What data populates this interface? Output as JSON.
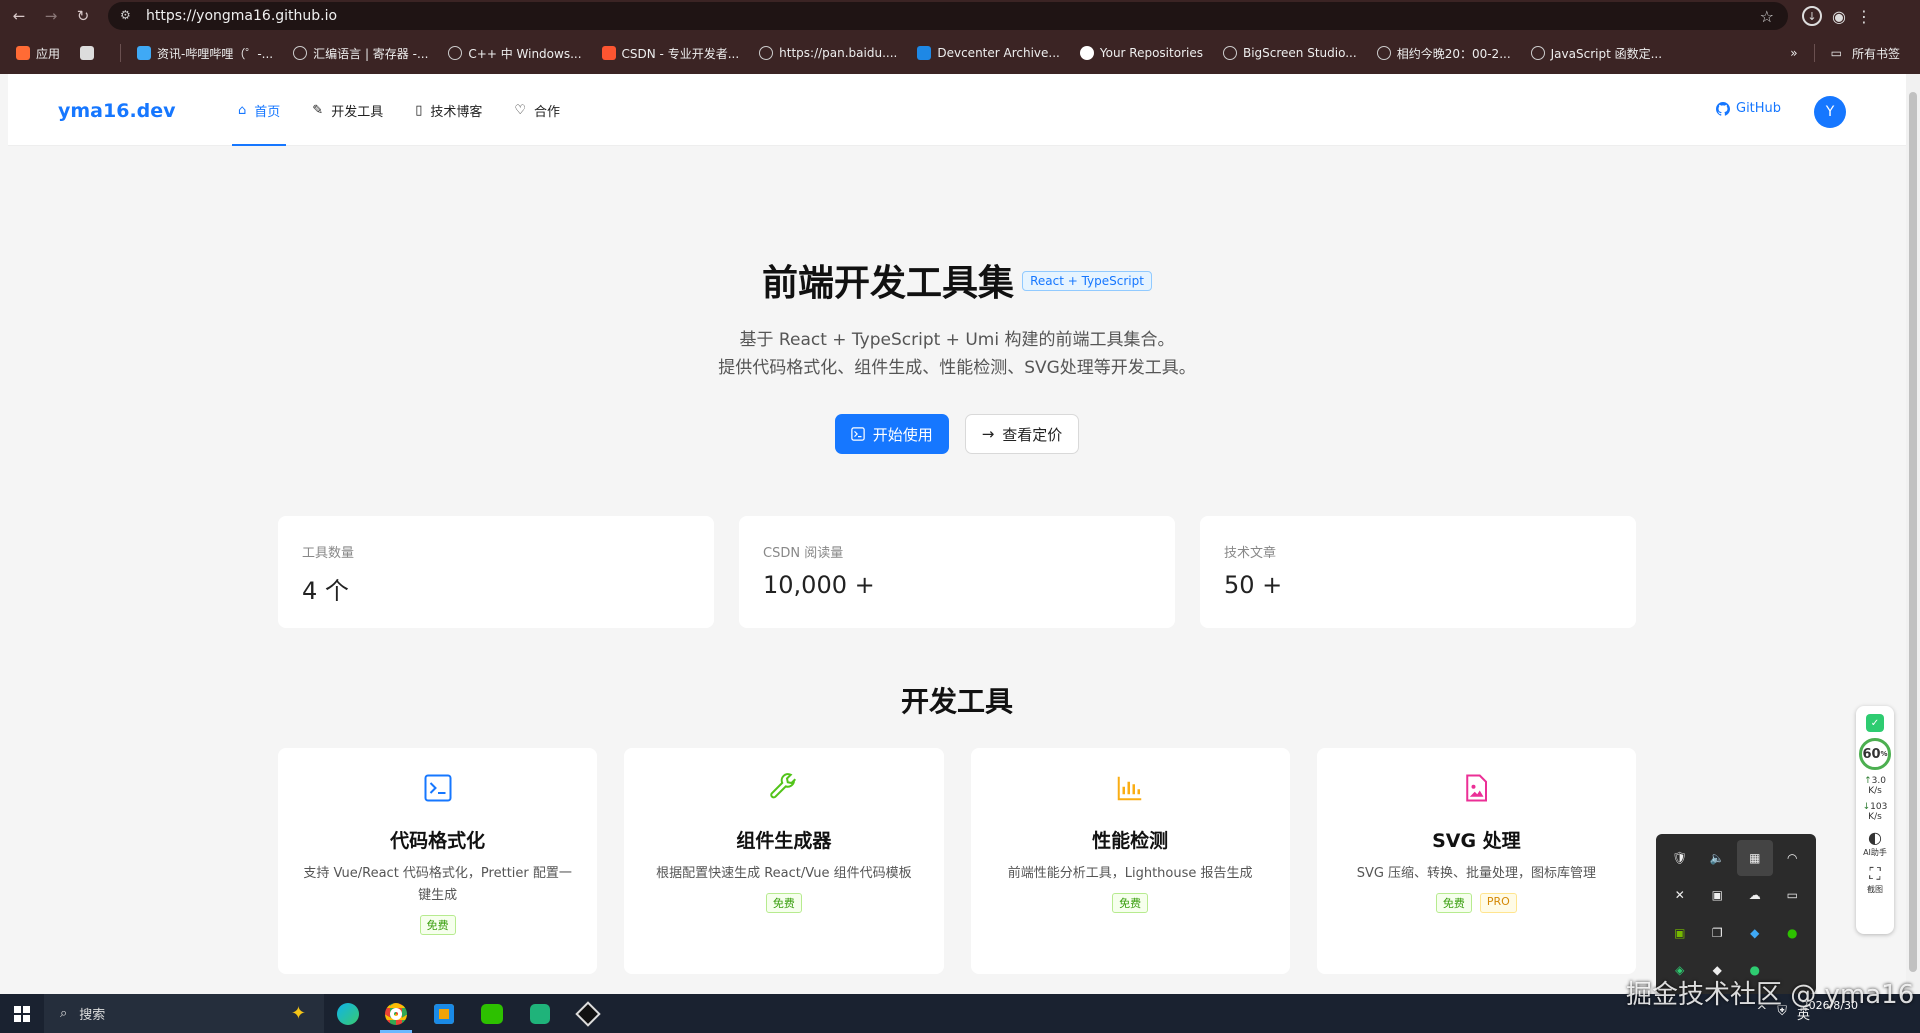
{
  "browser": {
    "url": "https://yongma16.github.io",
    "bookmarks": [
      {
        "label": "应用",
        "icon": "apps-grid-icon",
        "color": "#ff6b35"
      },
      {
        "label": "",
        "icon": "tab-groups-icon",
        "color": "#dddddd"
      },
      {
        "label": "资讯-哔哩哔哩（゜-...",
        "icon": "bilibili-icon",
        "color": "#3fa9f5"
      },
      {
        "label": "汇编语言 | 寄存器 -...",
        "icon": "globe-icon",
        "color": "#cccccc"
      },
      {
        "label": "C++ 中 Windows...",
        "icon": "globe-icon",
        "color": "#cccccc"
      },
      {
        "label": "CSDN - 专业开发者...",
        "icon": "csdn-icon",
        "color": "#fc5531"
      },
      {
        "label": "https://pan.baidu....",
        "icon": "globe-icon",
        "color": "#cccccc"
      },
      {
        "label": "Devcenter Archive...",
        "icon": "devcenter-icon",
        "color": "#1e88e5"
      },
      {
        "label": "Your Repositories",
        "icon": "github-icon",
        "color": "#ffffff"
      },
      {
        "label": "BigScreen Studio...",
        "icon": "globe-icon",
        "color": "#cccccc"
      },
      {
        "label": "相约今晚20：00-2...",
        "icon": "globe-icon",
        "color": "#cccccc"
      },
      {
        "label": "JavaScript 函数定...",
        "icon": "globe-icon",
        "color": "#cccccc"
      }
    ],
    "more_label": "»",
    "all_bookmarks": "所有书签"
  },
  "site": {
    "logo": "yma16.dev",
    "menu": [
      {
        "label": "首页",
        "icon": "home-icon",
        "active": true
      },
      {
        "label": "开发工具",
        "icon": "tool-icon",
        "active": false
      },
      {
        "label": "技术博客",
        "icon": "book-icon",
        "active": false
      },
      {
        "label": "合作",
        "icon": "handshake-icon",
        "active": false
      }
    ],
    "github_label": "GitHub",
    "avatar_letter": "Y",
    "brand_color": "#1677ff"
  },
  "hero": {
    "title": "前端开发工具集",
    "tag": "React + TypeScript",
    "desc_line1": "基于 React + TypeScript + Umi 构建的前端工具集合。",
    "desc_line2": "提供代码格式化、组件生成、性能检测、SVG处理等开发工具。",
    "primary_btn": "开始使用",
    "secondary_btn": "查看定价"
  },
  "stats": [
    {
      "label": "工具数量",
      "value": "4 个"
    },
    {
      "label": "CSDN 阅读量",
      "value": "10,000 +"
    },
    {
      "label": "技术文章",
      "value": "50 +"
    }
  ],
  "tools_section": {
    "title": "开发工具",
    "tools": [
      {
        "name": "代码格式化",
        "desc": "支持 Vue/React 代码格式化，Prettier 配置一键生成",
        "icon": "code-terminal-icon",
        "color": "#1677ff",
        "tags": [
          "免费"
        ]
      },
      {
        "name": "组件生成器",
        "desc": "根据配置快速生成 React/Vue 组件代码模板",
        "icon": "wrench-icon",
        "color": "#52c41a",
        "tags": [
          "免费"
        ]
      },
      {
        "name": "性能检测",
        "desc": "前端性能分析工具，Lighthouse 报告生成",
        "icon": "bar-chart-icon",
        "color": "#faad14",
        "tags": [
          "免费"
        ]
      },
      {
        "name": "SVG 处理",
        "desc": "SVG 压缩、转换、批量处理，图标库管理",
        "icon": "image-file-icon",
        "color": "#eb2f96",
        "tags": [
          "免费",
          "PRO"
        ]
      }
    ]
  },
  "taskbar": {
    "search_label": "搜索",
    "time": "",
    "date": "2026/8/30",
    "tray_lang": "英"
  },
  "widget": {
    "perf_percent": "60",
    "up_speed": "3.0",
    "up_unit": "K/s",
    "down_speed": "103",
    "down_unit": "K/s",
    "ai_label": "AI助手",
    "shot_label": "截图"
  },
  "watermark": "掘金技术社区 @ yma16"
}
